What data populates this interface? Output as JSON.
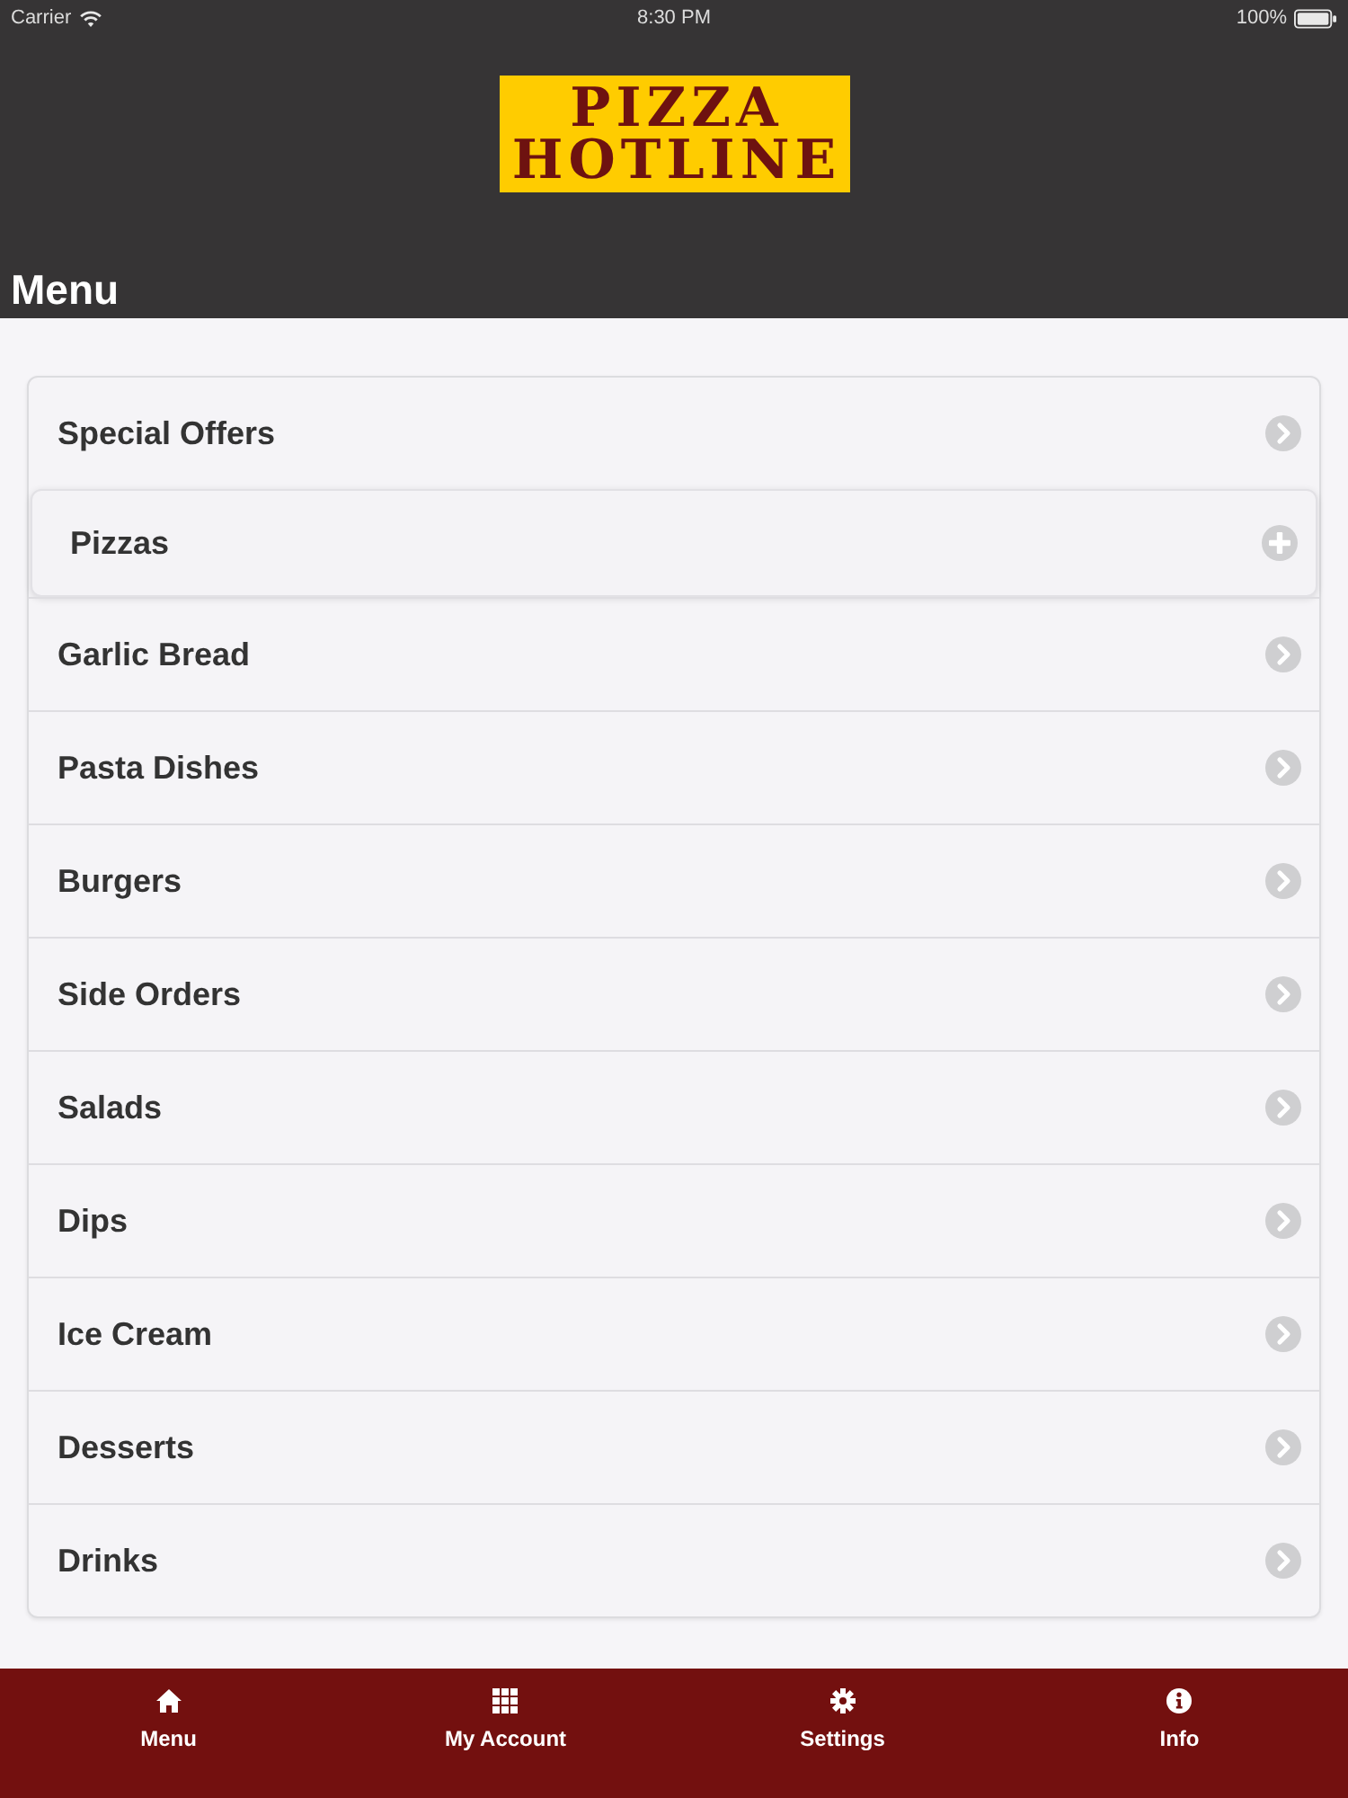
{
  "status_bar": {
    "carrier": "Carrier",
    "time": "8:30 PM",
    "battery": "100%"
  },
  "header": {
    "logo": {
      "lines": [
        "PIZZA",
        "HOTLINE"
      ]
    },
    "title": "Menu"
  },
  "menu": {
    "items": [
      {
        "label": "Special Offers",
        "kind": "link"
      },
      {
        "label": "Pizzas",
        "kind": "collapsible"
      },
      {
        "label": "Garlic Bread",
        "kind": "link"
      },
      {
        "label": "Pasta Dishes",
        "kind": "link"
      },
      {
        "label": "Burgers",
        "kind": "link"
      },
      {
        "label": "Side Orders",
        "kind": "link"
      },
      {
        "label": "Salads",
        "kind": "link"
      },
      {
        "label": "Dips",
        "kind": "link"
      },
      {
        "label": "Ice Cream",
        "kind": "link"
      },
      {
        "label": "Desserts",
        "kind": "link"
      },
      {
        "label": "Drinks",
        "kind": "link"
      }
    ]
  },
  "tab_bar": {
    "tabs": [
      {
        "label": "Menu"
      },
      {
        "label": "My Account"
      },
      {
        "label": "Settings"
      },
      {
        "label": "Info"
      }
    ]
  }
}
